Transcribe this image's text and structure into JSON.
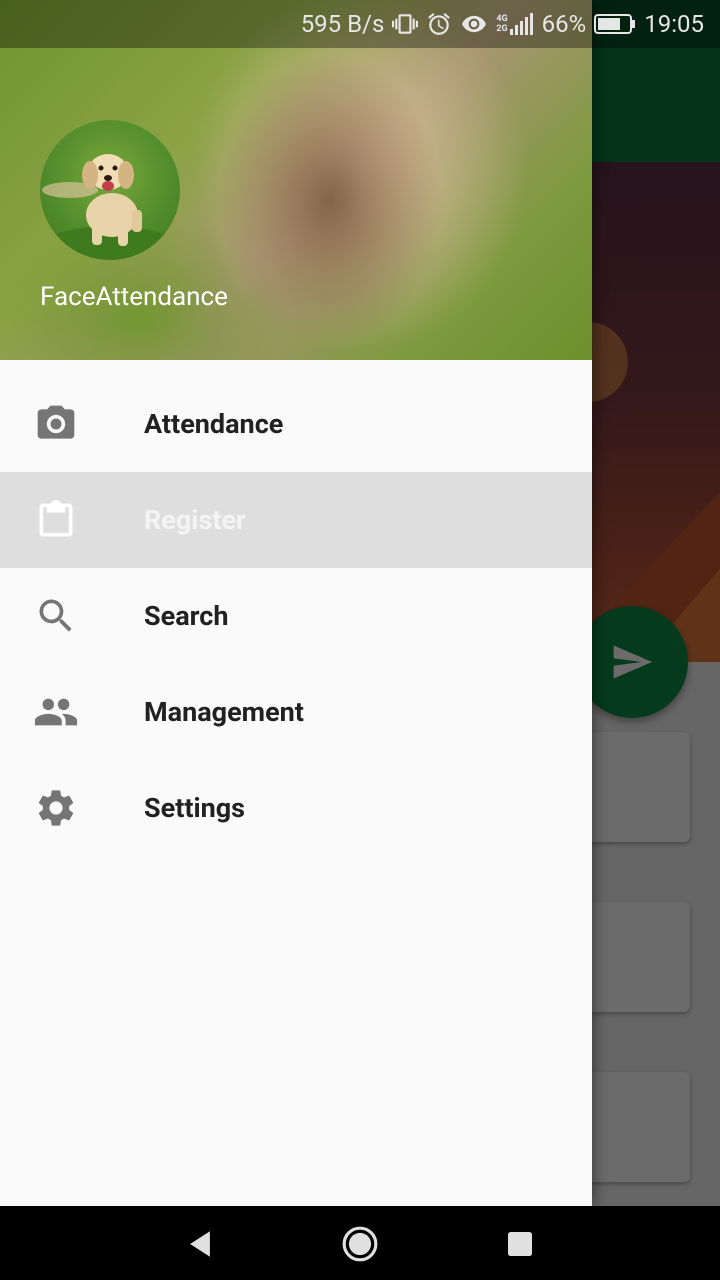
{
  "status_bar": {
    "net_speed": "595 B/s",
    "net_type_top": "4G",
    "net_type_bottom": "2G",
    "battery_percent": "66%",
    "time": "19:05",
    "icons": [
      "vibrate-icon",
      "alarm-icon",
      "eye-icon",
      "signal-icon",
      "battery-icon"
    ]
  },
  "drawer": {
    "header": {
      "title": "FaceAttendance",
      "avatar": "puppy-avatar"
    },
    "menu": [
      {
        "label": "Attendance",
        "icon": "camera-icon",
        "selected": false
      },
      {
        "label": "Register",
        "icon": "clipboard-icon",
        "selected": true
      },
      {
        "label": "Search",
        "icon": "search-icon",
        "selected": false
      },
      {
        "label": "Management",
        "icon": "people-icon",
        "selected": false
      },
      {
        "label": "Settings",
        "icon": "gear-icon",
        "selected": false
      }
    ]
  },
  "background_app": {
    "fab_icon": "send-icon",
    "toolbar_color": "#0a7a3c",
    "fab_color": "#0c8a45"
  },
  "nav_bar": {
    "buttons": [
      "back-icon",
      "home-icon",
      "recents-icon"
    ]
  },
  "colors": {
    "selected_item_bg": "#dedede",
    "icon_gray": "#757575",
    "label_dark": "#212121"
  }
}
